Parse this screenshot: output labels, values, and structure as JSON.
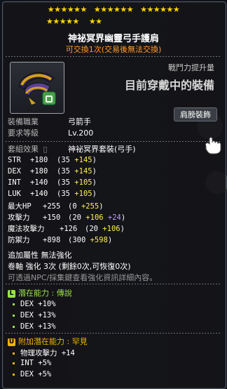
{
  "stars": {
    "row1": [
      "★★★★★★",
      "★★★★★★",
      "★★★★★★"
    ],
    "row2": [
      "★★★★★",
      "★★"
    ]
  },
  "item": {
    "name": "神祕冥界幽靈弓手護肩",
    "trade": "可交換1次(交易後無法交換)",
    "cp_label": "戰鬥力提升量",
    "cp_value": "目前穿戴中的裝備",
    "equip_type": "肩膀裝飾",
    "job_label": "裝備職業",
    "job_value": "弓箭手",
    "req_label": "要求等級",
    "req_value": "Lv.200",
    "set_label": "套組效果",
    "set_value": "神祕冥界套裝(弓手)"
  },
  "stats": [
    {
      "name": "STR",
      "total": "+180",
      "base": "(35 ",
      "bonus": "+145",
      "end": ")"
    },
    {
      "name": "DEX",
      "total": "+180",
      "base": "(35 ",
      "bonus": "+145",
      "end": ")"
    },
    {
      "name": "INT",
      "total": "+140",
      "base": "(35 ",
      "bonus": "+105",
      "end": ")"
    },
    {
      "name": "LUK",
      "total": "+140",
      "base": "(35 ",
      "bonus": "+105",
      "end": ")"
    },
    {
      "name": "最大HP",
      "total": "+255",
      "base": "(0 ",
      "bonus": "+255",
      "end": ")"
    }
  ],
  "combat_stats": [
    {
      "name": "攻擊力",
      "total": "+150",
      "base": "(20 ",
      "bonus": "+106",
      "extra": " +24",
      "end": ")"
    },
    {
      "name": "魔法攻擊力",
      "total": "+126",
      "base": "(20 ",
      "bonus": "+106",
      "extra": "",
      "end": ")"
    },
    {
      "name": "防禦力",
      "total": "+898",
      "base": "(300 ",
      "bonus": "+598",
      "end": ")"
    }
  ],
  "extra": {
    "attr": "追加屬性 無法強化",
    "scroll": "卷軸 強化 3次 (剩餘0次,可恢復0次)",
    "hint": "可透過NPC/採集鍵查看強化資訊詳細內容。"
  },
  "potential": {
    "badge": "L",
    "title": "潛在能力 : 傳說",
    "color": "#9be34a",
    "lines": [
      "DEX +10%",
      "DEX +13%",
      "DEX +13%"
    ]
  },
  "additional": {
    "badge": "U",
    "title": "附加潛在能力 : 罕見",
    "color": "#f5b300",
    "lines": [
      "物理攻擊力 +14",
      "INT +5%",
      "DEX +5%"
    ]
  }
}
